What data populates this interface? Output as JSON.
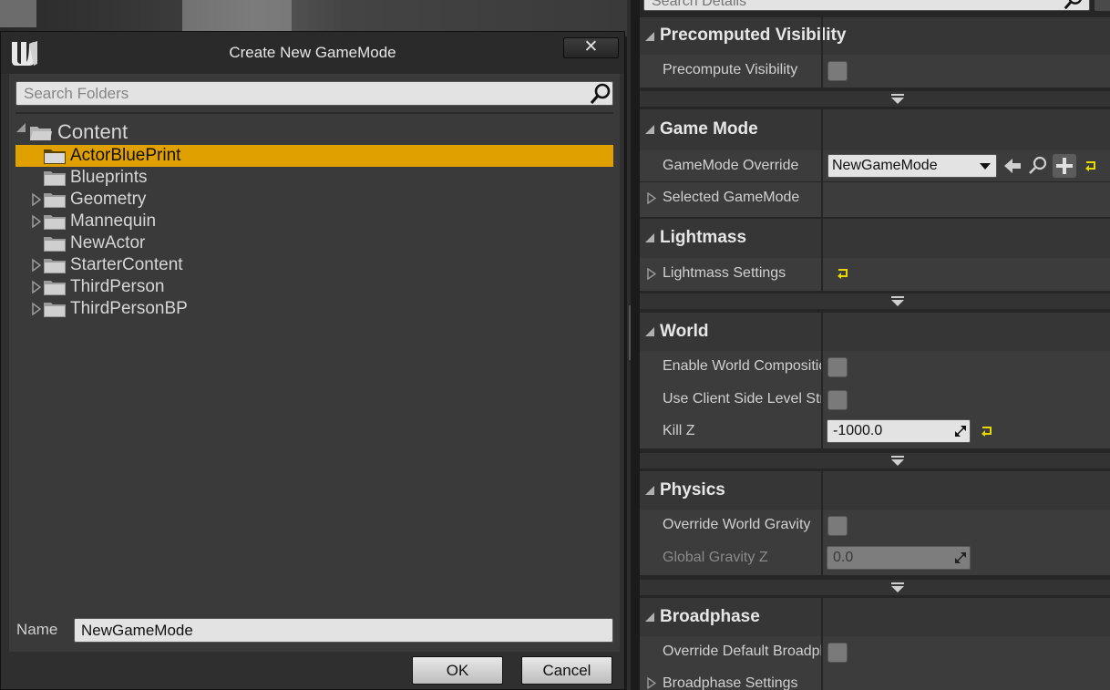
{
  "dialog": {
    "title": "Create New GameMode",
    "close_glyph": "✕",
    "search_placeholder": "Search Folders",
    "tree": {
      "root": "Content",
      "items": [
        {
          "label": "ActorBluePrint",
          "expandable": false,
          "selected": true
        },
        {
          "label": "Blueprints",
          "expandable": false,
          "selected": false
        },
        {
          "label": "Geometry",
          "expandable": true,
          "selected": false
        },
        {
          "label": "Mannequin",
          "expandable": true,
          "selected": false
        },
        {
          "label": "NewActor",
          "expandable": false,
          "selected": false
        },
        {
          "label": "StarterContent",
          "expandable": true,
          "selected": false
        },
        {
          "label": "ThirdPerson",
          "expandable": true,
          "selected": false
        },
        {
          "label": "ThirdPersonBP",
          "expandable": true,
          "selected": false
        }
      ]
    },
    "name_label": "Name",
    "name_value": "NewGameMode",
    "ok_label": "OK",
    "cancel_label": "Cancel"
  },
  "details": {
    "search_placeholder": "Search Details",
    "categories": {
      "precomputed_visibility": {
        "title": "Precomputed Visibility",
        "precompute_visibility": "Precompute Visibility"
      },
      "game_mode": {
        "title": "Game Mode",
        "gamemode_override": "GameMode Override",
        "gamemode_value": "NewGameMode",
        "selected_gamemode": "Selected GameMode"
      },
      "lightmass": {
        "title": "Lightmass",
        "lightmass_settings": "Lightmass Settings"
      },
      "world": {
        "title": "World",
        "enable_world_composition": "Enable World Composition",
        "use_client_side_level_streaming": "Use Client Side Level Streaming",
        "kill_z": "Kill Z",
        "kill_z_value": "-1000.0"
      },
      "physics": {
        "title": "Physics",
        "override_world_gravity": "Override World Gravity",
        "global_gravity_z": "Global Gravity Z",
        "global_gravity_z_value": "0.0"
      },
      "broadphase": {
        "title": "Broadphase",
        "override_default_broadphase": "Override Default Broadphase Settings",
        "broadphase_settings": "Broadphase Settings"
      }
    }
  },
  "colors": {
    "selection": "#e0a100",
    "reset_arrow": "#e6d800",
    "panel_bg": "#262626"
  }
}
